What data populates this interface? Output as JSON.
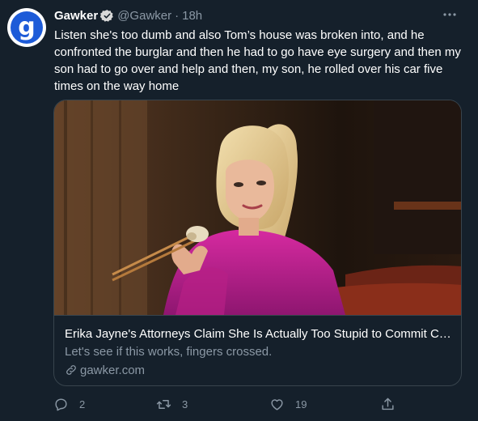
{
  "tweet": {
    "author_name": "Gawker",
    "author_handle": "@Gawker",
    "separator": "·",
    "timestamp": "18h",
    "avatar_letter": "g",
    "text": "Listen she's too dumb and also Tom’s house was broken into, and he confronted the burglar and then he had to go have eye surgery and then my son had to go over and help and then, my son, he rolled over his car five times on the way home"
  },
  "card": {
    "title": "Erika Jayne's Attorneys Claim She Is Actually Too Stupid to Commit Crimes",
    "description": "Let's see if this works, fingers crossed.",
    "domain": "gawker.com"
  },
  "actions": {
    "reply_count": "2",
    "retweet_count": "3",
    "like_count": "19"
  },
  "colors": {
    "background": "#15202b",
    "secondary_text": "#8b98a5",
    "border": "#38444d",
    "verified_badge": "#d9d9d9",
    "avatar_brand": "#1d5bd8"
  },
  "icons": [
    "verified-badge-icon",
    "more-icon",
    "link-icon",
    "reply-icon",
    "retweet-icon",
    "like-icon",
    "share-icon"
  ]
}
